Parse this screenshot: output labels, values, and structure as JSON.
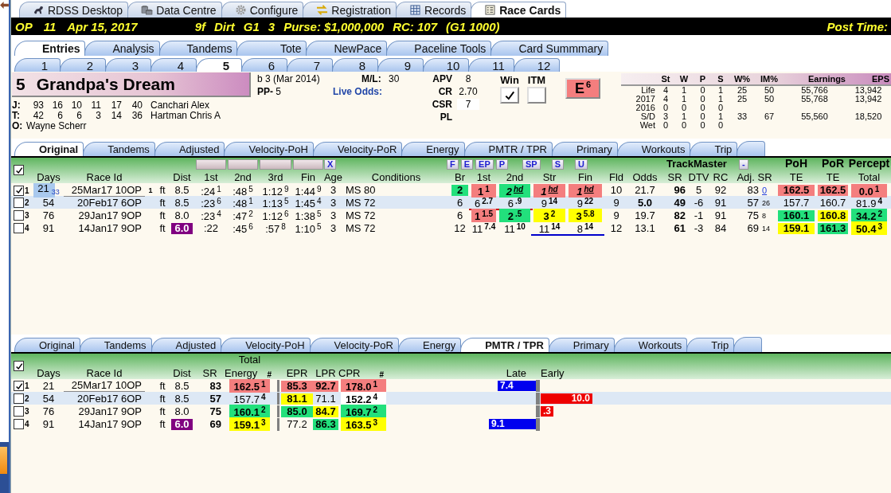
{
  "app_tabs": [
    {
      "label": "RDSS Desktop",
      "selected": false
    },
    {
      "label": "Data Centre",
      "selected": false
    },
    {
      "label": "Configure",
      "selected": false
    },
    {
      "label": "Registration",
      "selected": false
    },
    {
      "label": "Records",
      "selected": false
    },
    {
      "label": "Race Cards",
      "selected": true
    }
  ],
  "race_header": {
    "track": "OP",
    "race": "11",
    "date": "Apr 15, 2017",
    "details": [
      "9f",
      "Dirt",
      "G1",
      "3",
      "Purse: $1,000,000",
      "RC: 107",
      "(G1 1000)"
    ],
    "post_time": "Post Time:"
  },
  "view_tabs": [
    {
      "label": "Entries",
      "selected": true
    },
    {
      "label": "Analysis",
      "selected": false
    },
    {
      "label": "Tandems",
      "selected": false
    },
    {
      "label": "Tote",
      "selected": false
    },
    {
      "label": "NewPace",
      "selected": false
    },
    {
      "label": "Paceline Tools",
      "selected": false
    },
    {
      "label": "Card Summmary",
      "selected": false
    }
  ],
  "horse_tabs": [
    {
      "label": "1",
      "selected": false
    },
    {
      "label": "2",
      "selected": false
    },
    {
      "label": "3",
      "selected": false
    },
    {
      "label": "4",
      "selected": false
    },
    {
      "label": "5",
      "selected": true
    },
    {
      "label": "6",
      "selected": false
    },
    {
      "label": "7",
      "selected": false
    },
    {
      "label": "8",
      "selected": false
    },
    {
      "label": "9",
      "selected": false
    },
    {
      "label": "10",
      "selected": false
    },
    {
      "label": "11",
      "selected": false
    },
    {
      "label": "12",
      "selected": false
    }
  ],
  "horse": {
    "number": "5",
    "name": "Grandpa's Dream",
    "description": "b 3 (Mar 2014)",
    "pp_label": "PP-",
    "pp": "5",
    "ml_label": "M/L:",
    "ml": "30",
    "live_odds_label": "Live Odds:",
    "connections": [
      {
        "label": "J:",
        "stats": [
          "93",
          "16",
          "10",
          "11",
          "17",
          "40"
        ],
        "name": "Canchari Alex"
      },
      {
        "label": "T:",
        "stats": [
          "42",
          "6",
          "6",
          "3",
          "14",
          "36"
        ],
        "name": "Hartman Chris A"
      }
    ],
    "owner": {
      "label": "O:",
      "name": "Wayne Scherr"
    },
    "ratings": [
      {
        "label": "APV",
        "value": "8"
      },
      {
        "label": "CR",
        "value": "2.70"
      },
      {
        "label": "CSR",
        "value": "7"
      },
      {
        "label": "PL"
      }
    ],
    "bets": [
      {
        "label": "Win",
        "checked": true
      },
      {
        "label": "ITM",
        "checked": false
      }
    ],
    "style_button": {
      "label": "E",
      "sup": "6"
    }
  },
  "record": {
    "columns": [
      "St",
      "W",
      "P",
      "S",
      "W%",
      "IM%",
      "Earnings",
      "EPS"
    ],
    "rows": [
      {
        "label": "Life",
        "cells": [
          "4",
          "1",
          "0",
          "1",
          "25",
          "50",
          "55,766",
          "13,942"
        ]
      },
      {
        "label": "2017",
        "cells": [
          "4",
          "1",
          "0",
          "1",
          "25",
          "50",
          "55,768",
          "13,942"
        ]
      },
      {
        "label": "2016",
        "cells": [
          "0",
          "0",
          "0",
          "0"
        ]
      },
      {
        "label": "S/D",
        "cells": [
          "3",
          "1",
          "0",
          "1",
          "33",
          "67",
          "55,560",
          "18,520"
        ]
      },
      {
        "label": "Wet",
        "cells": [
          "0",
          "0",
          "0",
          "0"
        ]
      }
    ]
  },
  "pace_tabs": [
    {
      "label": "Original",
      "selected": true
    },
    {
      "label": "Tandems",
      "selected": false
    },
    {
      "label": "Adjusted",
      "selected": false
    },
    {
      "label": "Velocity-PoH",
      "selected": false
    },
    {
      "label": "Velocity-PoR",
      "selected": false
    },
    {
      "label": "Energy",
      "selected": false
    },
    {
      "label": "PMTR / TPR",
      "selected": false
    },
    {
      "label": "Primary",
      "selected": false
    },
    {
      "label": "Workouts",
      "selected": false
    },
    {
      "label": "Trip",
      "selected": false
    }
  ],
  "past_races": {
    "all_checked": true,
    "columns": [
      "Days",
      "Race Id",
      "Dist",
      "1st",
      "2nd",
      "3rd",
      "Fin",
      "Age",
      "Conditions",
      "Br",
      "1st",
      "2nd",
      "Str",
      "Fin",
      "Fld",
      "Odds",
      "SR",
      "DTV",
      "RC",
      "Adj. SR",
      "TE",
      "TE",
      "Total"
    ],
    "clear_button": "X",
    "call_buttons": [
      "F",
      "E",
      "EP",
      "P"
    ],
    "late_buttons": [
      "SP",
      "S",
      "U"
    ],
    "group_label": "TrackMaster",
    "collapse_button": "-",
    "top_labels": [
      "PoH",
      "PoR",
      "Percept"
    ],
    "rows": [
      {
        "number": "1",
        "checked": true,
        "selected": false,
        "focused": true,
        "days": "21",
        "days_note": "33",
        "race_id": "25Mar17 10OP",
        "flag": "1",
        "surface": "ft",
        "dist": {
          "v": "8.5"
        },
        "fractions": [
          {
            "v": ":24",
            "sup": "1"
          },
          {
            "v": ":48",
            "sup": "5"
          },
          {
            "v": "1:12",
            "sup": "9"
          },
          {
            "v": "1:44",
            "sup": "9"
          }
        ],
        "age": "3",
        "conditions": "MS 80",
        "br": {
          "v": "2",
          "color": "#22e07c"
        },
        "calls": [
          {
            "v": "1",
            "sup": "1",
            "color": "#f47e7e"
          },
          {
            "v": "2",
            "sup": "hd",
            "color": "#22e07c",
            "emph": true
          },
          {
            "v": "1",
            "sup": "hd",
            "color": "#f47e7e",
            "emph": true
          },
          {
            "v": "1",
            "sup": "hd",
            "color": "#f47e7e",
            "emph": true
          }
        ],
        "fld": "10",
        "odds": "21.7",
        "favorite": false,
        "sr": "96",
        "dtv": "5",
        "rc": "92",
        "adj_sr": "83",
        "adj_rank": "0",
        "poh": {
          "v": "162.5",
          "color": "#f47e7e"
        },
        "por": {
          "v": "162.5",
          "color": "#f47e7e"
        },
        "percept": {
          "v": "0.0",
          "sup": "1",
          "color": "#f47e7e"
        }
      },
      {
        "number": "2",
        "checked": false,
        "selected": true,
        "focused": false,
        "days": "54",
        "race_id": "20Feb17 6OP",
        "surface": "ft",
        "dist": {
          "v": "8.5"
        },
        "fractions": [
          {
            "v": ":23",
            "sup": "6"
          },
          {
            "v": ":48",
            "sup": "1"
          },
          {
            "v": "1:13",
            "sup": "5"
          },
          {
            "v": "1:45",
            "sup": "4"
          }
        ],
        "age": "3",
        "conditions": "MS 72",
        "br": {
          "v": "6"
        },
        "calls": [
          {
            "v": "6",
            "sup": "2.7",
            "underline": {
              "color": "#cc0000"
            }
          },
          {
            "v": "6",
            "sup": ".9",
            "underline": {
              "color": "#cc0000"
            }
          },
          {
            "v": "9",
            "sup": "14"
          },
          {
            "v": "9",
            "sup": "22"
          }
        ],
        "fld": "9",
        "odds": "5.0",
        "favorite": true,
        "sr": "49",
        "dtv": "-6",
        "rc": "91",
        "adj_sr": "57",
        "adj_rank": "26",
        "poh": {
          "v": "157.7"
        },
        "por": {
          "v": "160.7"
        },
        "percept": {
          "v": "81.9",
          "sup": "4"
        }
      },
      {
        "number": "3",
        "checked": false,
        "selected": false,
        "focused": false,
        "days": "76",
        "race_id": "29Jan17 9OP",
        "surface": "ft",
        "dist": {
          "v": "8.0"
        },
        "fractions": [
          {
            "v": ":23",
            "sup": "4"
          },
          {
            "v": ":47",
            "sup": "2"
          },
          {
            "v": "1:12",
            "sup": "6"
          },
          {
            "v": "1:38",
            "sup": "5"
          }
        ],
        "age": "3",
        "conditions": "MS 72",
        "br": {
          "v": "6"
        },
        "calls": [
          {
            "v": "1",
            "sup": "1.5",
            "color": "#f47e7e"
          },
          {
            "v": "2",
            "sup": ".5",
            "color": "#22e07c"
          },
          {
            "v": "3",
            "sup": "2",
            "color": "#ffff00"
          },
          {
            "v": "3",
            "sup": "5.8",
            "color": "#ffff00"
          }
        ],
        "fld": "9",
        "odds": "19.7",
        "favorite": false,
        "sr": "82",
        "dtv": "-1",
        "rc": "91",
        "adj_sr": "75",
        "adj_rank": "8",
        "poh": {
          "v": "160.1",
          "color": "#22e07c"
        },
        "por": {
          "v": "160.8",
          "color": "#ffff00"
        },
        "percept": {
          "v": "34.2",
          "sup": "2",
          "color": "#22e07c"
        }
      },
      {
        "number": "4",
        "checked": false,
        "selected": false,
        "focused": false,
        "days": "91",
        "race_id": "14Jan17 9OP",
        "surface": "ft",
        "dist": {
          "v": "6.0",
          "color": "#800080"
        },
        "fractions": [
          {
            "v": ":22"
          },
          {
            "v": ":45",
            "sup": "6"
          },
          {
            "v": ":57",
            "sup": "8"
          },
          {
            "v": "1:10",
            "sup": "5"
          }
        ],
        "age": "3",
        "conditions": "MS 72",
        "br": {
          "v": "12"
        },
        "calls": [
          {
            "v": "11",
            "sup": "7.4"
          },
          {
            "v": "11",
            "sup": "10"
          },
          {
            "v": "11",
            "sup": "14",
            "underline": {
              "color": "#0000cc"
            }
          },
          {
            "v": "8",
            "sup": "14",
            "underline": {
              "color": "#0000cc"
            }
          }
        ],
        "fld": "12",
        "odds": "13.1",
        "favorite": false,
        "sr": "61",
        "dtv": "-3",
        "rc": "84",
        "adj_sr": "69",
        "adj_rank": "14",
        "poh": {
          "v": "159.1",
          "color": "#ffff00"
        },
        "por": {
          "v": "161.3",
          "color": "#22e07c"
        },
        "percept": {
          "v": "50.4",
          "sup": "3",
          "color": "#ffff00"
        }
      }
    ]
  },
  "pmtr_tabs": [
    {
      "label": "Original",
      "selected": false
    },
    {
      "label": "Tandems",
      "selected": false
    },
    {
      "label": "Adjusted",
      "selected": false
    },
    {
      "label": "Velocity-PoH",
      "selected": false
    },
    {
      "label": "Velocity-PoR",
      "selected": false
    },
    {
      "label": "Energy",
      "selected": false
    },
    {
      "label": "PMTR / TPR",
      "selected": true
    },
    {
      "label": "Primary",
      "selected": false
    },
    {
      "label": "Workouts",
      "selected": false
    },
    {
      "label": "Trip",
      "selected": false
    }
  ],
  "pmtr": {
    "all_checked": true,
    "columns": [
      "Days",
      "Race Id",
      "Dist",
      "SR",
      "Energy",
      "#",
      "EPR",
      "LPR",
      "CPR",
      "#",
      "Late",
      "Early"
    ],
    "top_labels": [
      "Total"
    ],
    "rows": [
      {
        "number": "1",
        "checked": true,
        "selected": false,
        "focused": true,
        "days": "21",
        "race_id": "25Mar17 10OP",
        "surface": "ft",
        "dist": {
          "v": "8.5"
        },
        "sr": "83",
        "energy": {
          "v": "162.5",
          "sup": "1",
          "color": "#f47e7e"
        },
        "epr": {
          "v": "85.3",
          "color": "#f47e7e"
        },
        "lpr": {
          "v": "92.7",
          "color": "#f47e7e"
        },
        "cpr": {
          "v": "178.0",
          "sup": "1",
          "color": "#f47e7e"
        },
        "bar": {
          "kind": "late",
          "value": "7.4"
        }
      },
      {
        "number": "2",
        "checked": false,
        "selected": true,
        "focused": false,
        "days": "54",
        "race_id": "20Feb17 6OP",
        "surface": "ft",
        "dist": {
          "v": "8.5"
        },
        "sr": "57",
        "energy": {
          "v": "157.7",
          "sup": "4"
        },
        "epr": {
          "v": "81.1",
          "color": "#ffff00"
        },
        "lpr": {
          "v": "71.1"
        },
        "cpr": {
          "v": "152.2",
          "sup": "4",
          "color": "#ffffff"
        },
        "bar": {
          "kind": "early",
          "value": "10.0"
        }
      },
      {
        "number": "3",
        "checked": false,
        "selected": false,
        "focused": false,
        "days": "76",
        "race_id": "29Jan17 9OP",
        "surface": "ft",
        "dist": {
          "v": "8.0"
        },
        "sr": "75",
        "energy": {
          "v": "160.1",
          "sup": "2",
          "color": "#22e07c"
        },
        "epr": {
          "v": "85.0",
          "color": "#22e07c"
        },
        "lpr": {
          "v": "84.7",
          "color": "#ffff00"
        },
        "cpr": {
          "v": "169.7",
          "sup": "2",
          "color": "#22e07c"
        },
        "bar": {
          "kind": "early",
          "value": ".3"
        }
      },
      {
        "number": "4",
        "checked": false,
        "selected": false,
        "focused": false,
        "days": "91",
        "race_id": "14Jan17 9OP",
        "surface": "ft",
        "dist": {
          "v": "6.0",
          "color": "#800080"
        },
        "sr": "69",
        "energy": {
          "v": "159.1",
          "sup": "3",
          "color": "#ffff00"
        },
        "epr": {
          "v": "77.2"
        },
        "lpr": {
          "v": "86.3",
          "color": "#22e07c"
        },
        "cpr": {
          "v": "163.5",
          "sup": "3",
          "color": "#ffff00"
        },
        "bar": {
          "kind": "late",
          "value": "9.1"
        }
      }
    ]
  }
}
